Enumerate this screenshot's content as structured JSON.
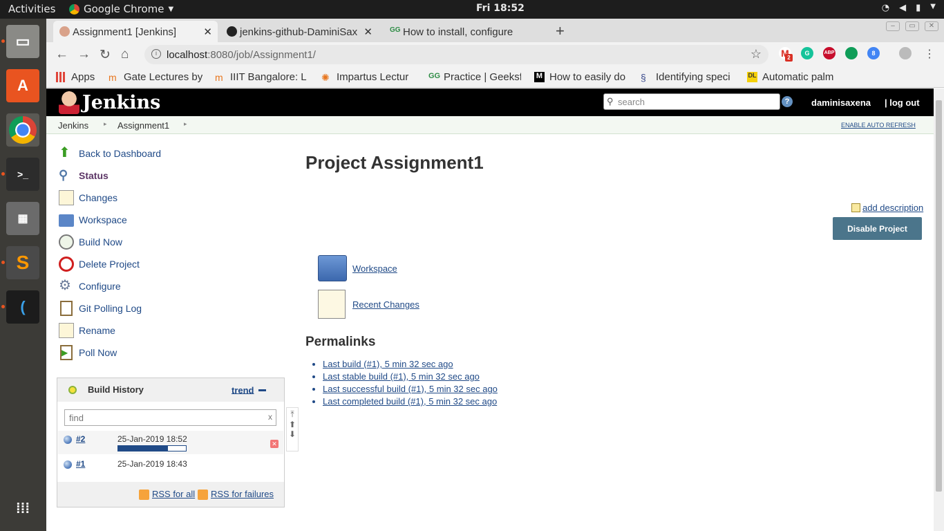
{
  "desktop": {
    "activities": "Activities",
    "app_name": "Google Chrome",
    "clock": "Fri 18:52"
  },
  "browser": {
    "tabs": [
      {
        "label": "Assignment1 [Jenkins]"
      },
      {
        "label": "jenkins-github-DaminiSax"
      },
      {
        "label": "How to install, configure"
      }
    ],
    "url_host": "localhost",
    "url_path": ":8080/job/Assignment1/",
    "extension_badge": "2",
    "bookmarks": [
      {
        "label": "Apps"
      },
      {
        "label": "Gate Lectures by"
      },
      {
        "label": "IIIT Bangalore: L"
      },
      {
        "label": "Impartus Lectur"
      },
      {
        "label": "Practice | Geeksf"
      },
      {
        "label": "How to easily do"
      },
      {
        "label": "Identifying speci"
      },
      {
        "label": "Automatic palm"
      }
    ]
  },
  "jenkins": {
    "logo_text": "Jenkins",
    "search_placeholder": "search",
    "help": "?",
    "user": "daminisaxena",
    "logout": "| log out",
    "breadcrumbs": [
      "Jenkins",
      "Assignment1"
    ],
    "auto_refresh": "ENABLE AUTO REFRESH",
    "sidebar": [
      {
        "label": "Back to Dashboard",
        "icon": "up-arrow-icon"
      },
      {
        "label": "Status",
        "icon": "magnifier-icon"
      },
      {
        "label": "Changes",
        "icon": "notepad-icon"
      },
      {
        "label": "Workspace",
        "icon": "folder-icon"
      },
      {
        "label": "Build Now",
        "icon": "clock-play-icon"
      },
      {
        "label": "Delete Project",
        "icon": "no-entry-icon"
      },
      {
        "label": "Configure",
        "icon": "gear-icon"
      },
      {
        "label": "Git Polling Log",
        "icon": "clipboard-icon"
      },
      {
        "label": "Rename",
        "icon": "notepad-icon"
      },
      {
        "label": "Poll Now",
        "icon": "clipboard-play-icon"
      }
    ],
    "build_history": {
      "title": "Build History",
      "trend": "trend",
      "find_placeholder": "find",
      "find_clear": "x",
      "builds": [
        {
          "number": "#2",
          "date": "25-Jan-2019 18:52",
          "progress": 0.73,
          "in_progress": true
        },
        {
          "number": "#1",
          "date": "25-Jan-2019 18:43",
          "in_progress": false
        }
      ],
      "rss_all": "RSS for all",
      "rss_failures": "RSS for failures"
    },
    "project_title": "Project Assignment1",
    "add_description": "add description",
    "disable_button": "Disable Project",
    "workspace_link": "Workspace",
    "recent_changes_link": "Recent Changes",
    "permalinks_title": "Permalinks",
    "permalinks": [
      "Last build (#1), 5 min 32 sec ago",
      "Last stable build (#1), 5 min 32 sec ago",
      "Last successful build (#1), 5 min 32 sec ago",
      "Last completed build (#1), 5 min 32 sec ago"
    ]
  }
}
